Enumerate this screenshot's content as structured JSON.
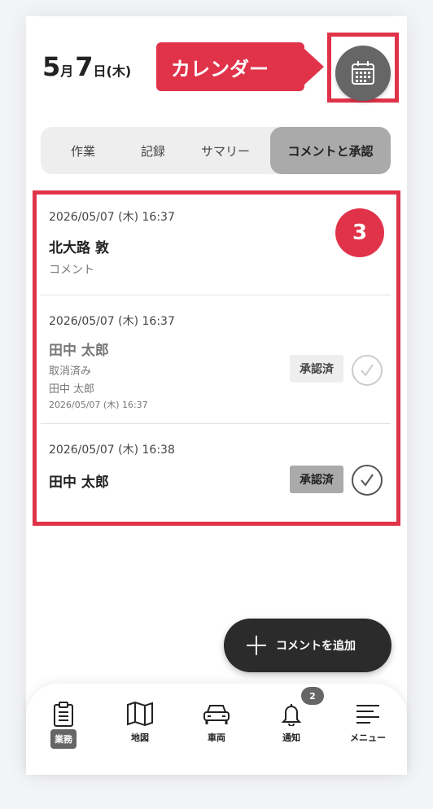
{
  "header": {
    "month": "5",
    "month_unit": "月",
    "day": "7",
    "day_unit": "日(木)",
    "calendar_callout": "カレンダー"
  },
  "tabs": [
    "作業",
    "記録",
    "サマリー",
    "コメントと承認"
  ],
  "active_tab": "コメントと承認",
  "annotation_number": "3",
  "comments": [
    {
      "timestamp": "2026/05/07 (木) 16:37",
      "author": "北大路 敦",
      "text": "コメント"
    },
    {
      "timestamp": "2026/05/07 (木) 16:37",
      "author": "田中 太郎",
      "status_text": "取消済み",
      "status_by": "田中 太郎",
      "status_time": "2026/05/07 (木) 16:37",
      "approval_label": "承認済"
    },
    {
      "timestamp": "2026/05/07 (木) 16:38",
      "author": "田中 太郎",
      "approval_label": "承認済"
    }
  ],
  "fab_label": "コメントを追加",
  "nav": {
    "items": [
      {
        "label": "業務",
        "icon": "clipboard-icon"
      },
      {
        "label": "地図",
        "icon": "map-icon"
      },
      {
        "label": "車両",
        "icon": "car-icon"
      },
      {
        "label": "通知",
        "icon": "bell-icon"
      },
      {
        "label": "メニュー",
        "icon": "menu-icon"
      }
    ],
    "notification_count": "2"
  },
  "colors": {
    "accent_red": "#e0334a",
    "gray_dark": "#666666",
    "fab_bg": "#2b2b2b"
  }
}
